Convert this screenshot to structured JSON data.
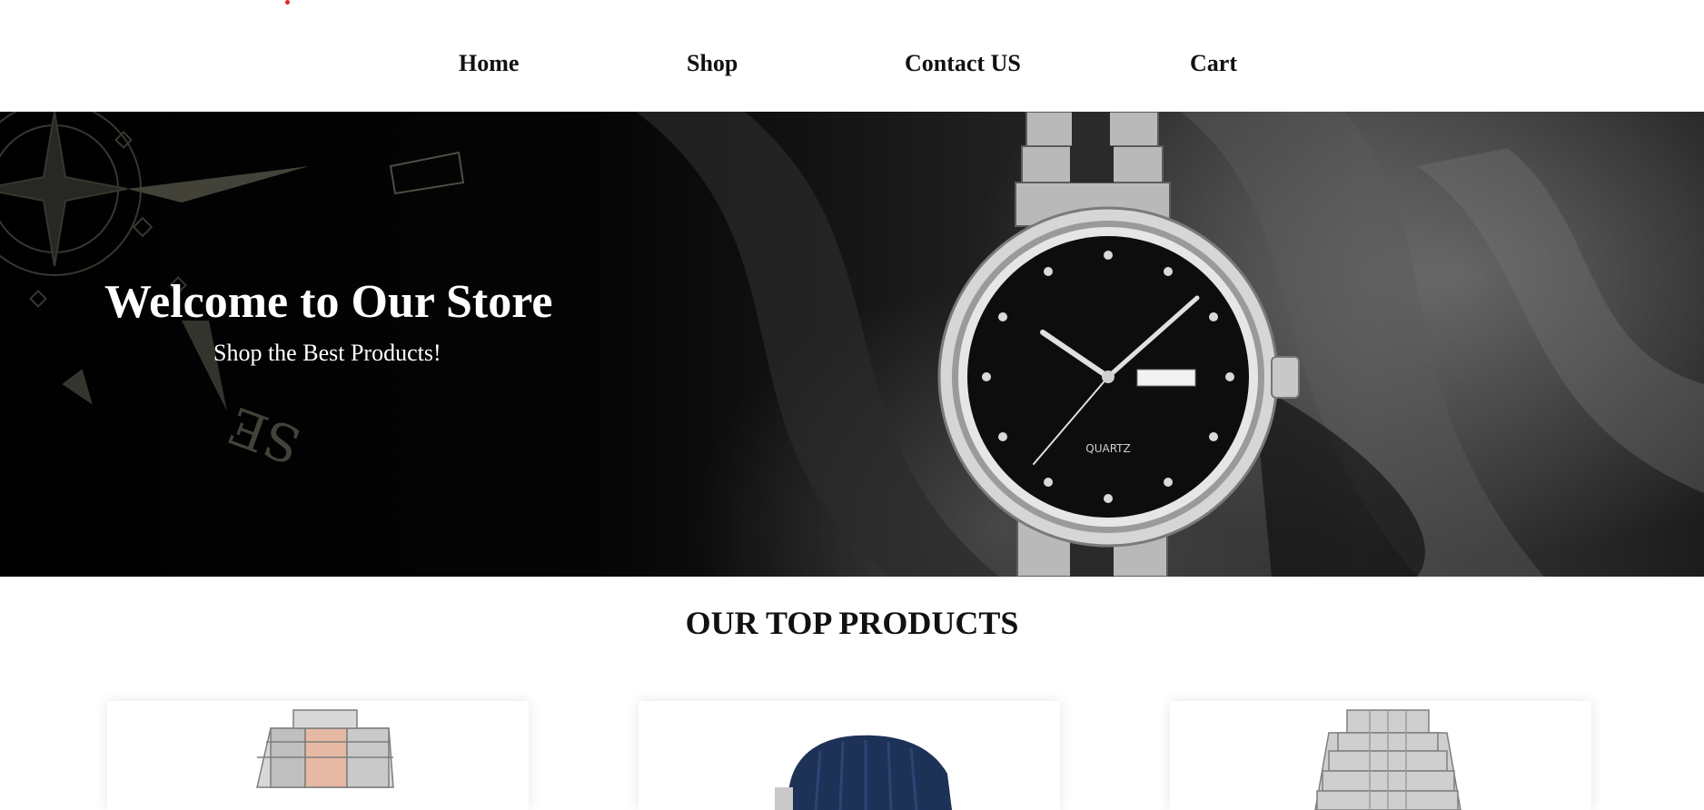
{
  "nav": {
    "items": [
      {
        "label": "Home"
      },
      {
        "label": "Shop"
      },
      {
        "label": "Contact US"
      },
      {
        "label": "Cart"
      }
    ]
  },
  "hero": {
    "title": "Welcome to Our Store",
    "subtitle": "Shop the Best Products!",
    "watch_text": "QUARTZ"
  },
  "products": {
    "heading": "OUR TOP PRODUCTS",
    "items": [
      {
        "image": "watch-rose-gold-steel-icon"
      },
      {
        "image": "watch-navy-rubber-strap-icon"
      },
      {
        "image": "watch-silver-jubilee-icon"
      }
    ]
  },
  "colors": {
    "accent_dot": "#e4232b",
    "nav_text": "#111111",
    "hero_bg": "#000000"
  }
}
